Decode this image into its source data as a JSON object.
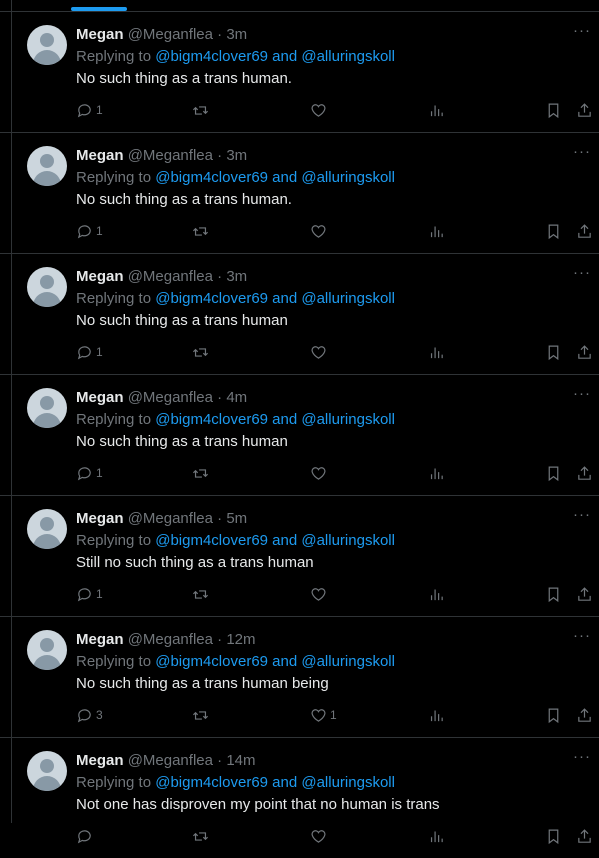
{
  "tweets": [
    {
      "name": "Megan",
      "handle": "@Meganflea",
      "time": "3m",
      "replying_prefix": "Replying to",
      "replying_to": "@bigm4clover69 and @alluringskoll",
      "text": "No such thing as a trans human.",
      "replies": "1",
      "retweets": "",
      "likes": "",
      "views": ""
    },
    {
      "name": "Megan",
      "handle": "@Meganflea",
      "time": "3m",
      "replying_prefix": "Replying to",
      "replying_to": "@bigm4clover69 and @alluringskoll",
      "text": "No such thing as a trans human.",
      "replies": "1",
      "retweets": "",
      "likes": "",
      "views": ""
    },
    {
      "name": "Megan",
      "handle": "@Meganflea",
      "time": "3m",
      "replying_prefix": "Replying to",
      "replying_to": "@bigm4clover69 and @alluringskoll",
      "text": "No such thing as a trans human",
      "replies": "1",
      "retweets": "",
      "likes": "",
      "views": ""
    },
    {
      "name": "Megan",
      "handle": "@Meganflea",
      "time": "4m",
      "replying_prefix": "Replying to",
      "replying_to": "@bigm4clover69 and @alluringskoll",
      "text": "No such thing as a trans human",
      "replies": "1",
      "retweets": "",
      "likes": "",
      "views": ""
    },
    {
      "name": "Megan",
      "handle": "@Meganflea",
      "time": "5m",
      "replying_prefix": "Replying to",
      "replying_to": "@bigm4clover69 and @alluringskoll",
      "text": "Still no such thing as a trans human",
      "replies": "1",
      "retweets": "",
      "likes": "",
      "views": ""
    },
    {
      "name": "Megan",
      "handle": "@Meganflea",
      "time": "12m",
      "replying_prefix": "Replying to",
      "replying_to": "@bigm4clover69 and @alluringskoll",
      "text": "No such thing as a trans human being",
      "replies": "3",
      "retweets": "",
      "likes": "1",
      "views": ""
    },
    {
      "name": "Megan",
      "handle": "@Meganflea",
      "time": "14m",
      "replying_prefix": "Replying to",
      "replying_to": "@bigm4clover69 and @alluringskoll",
      "text": "Not one has disproven my point that no human is trans",
      "replies": "",
      "retweets": "",
      "likes": "",
      "views": ""
    }
  ],
  "separator": "·",
  "more_glyph": "···",
  "colors": {
    "background": "#000000",
    "text": "#e7e9ea",
    "muted": "#71767b",
    "accent": "#1d9bf0",
    "divider": "#2f3336"
  },
  "icons": [
    "reply-icon",
    "retweet-icon",
    "like-icon",
    "views-icon",
    "bookmark-icon",
    "share-icon",
    "more-icon"
  ]
}
